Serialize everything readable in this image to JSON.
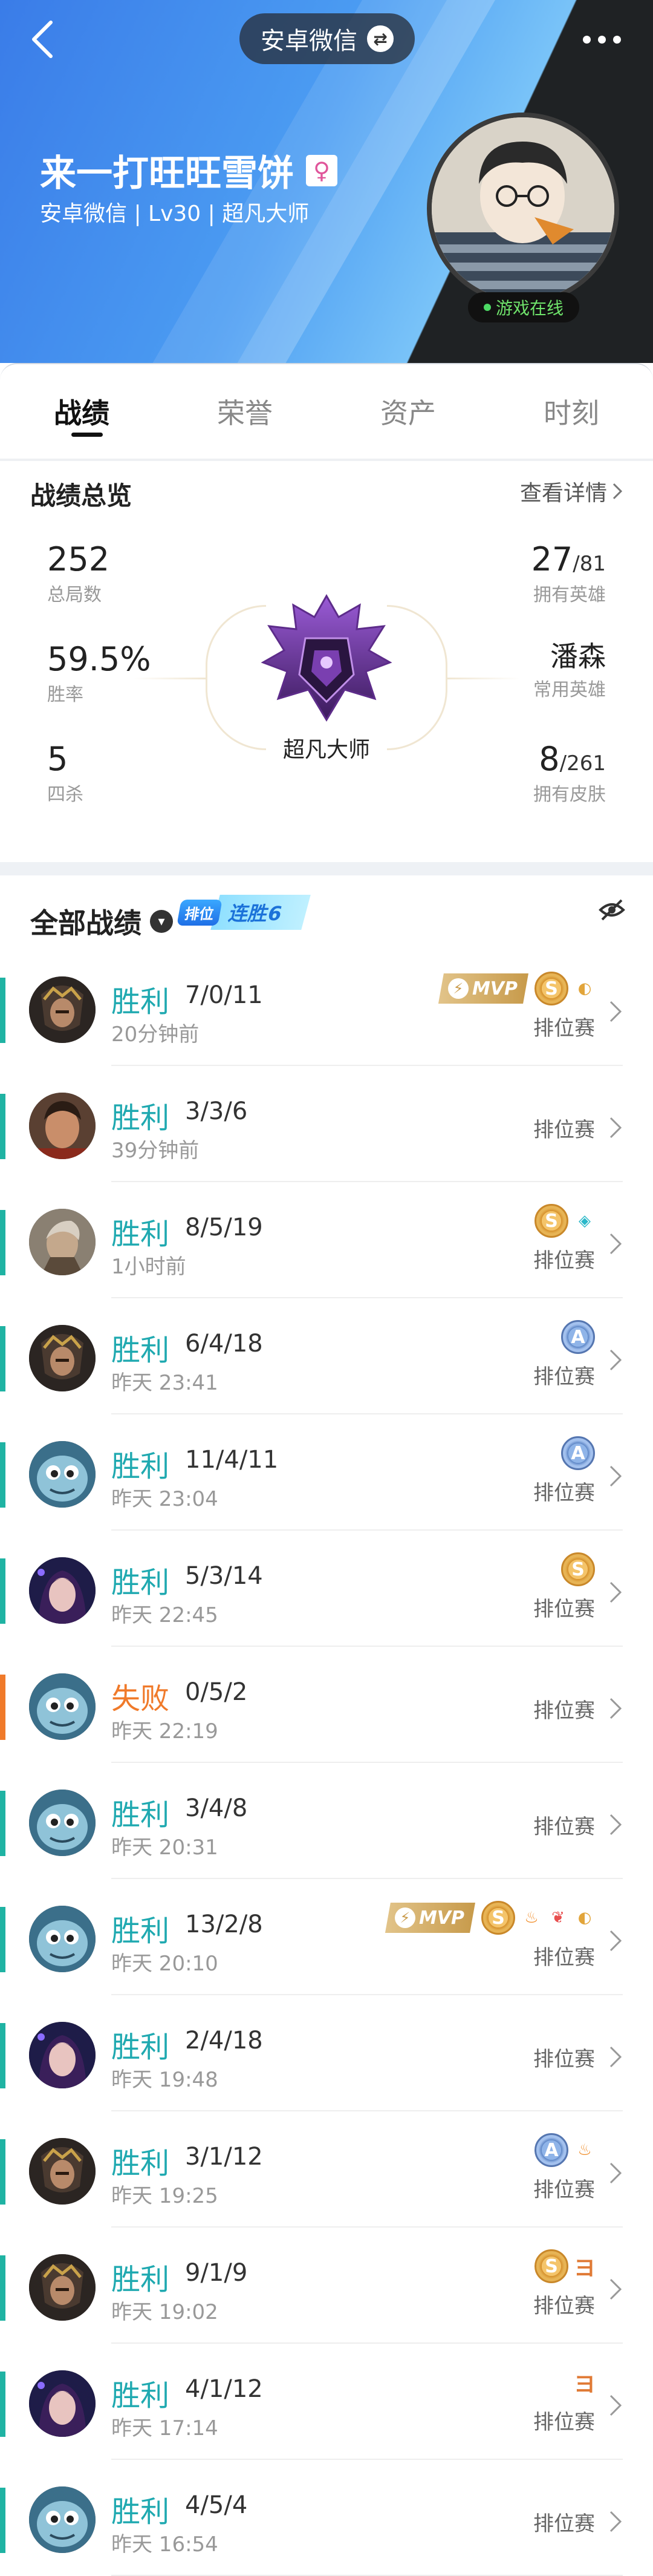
{
  "header": {
    "platform": "安卓微信",
    "player_name": "来一打旺旺雪饼",
    "player_sub": "安卓微信 | Lv30 | 超凡大师",
    "online_status": "游戏在线",
    "gender_icon": "female-icon"
  },
  "tabs": [
    {
      "label": "战绩",
      "active": true
    },
    {
      "label": "荣誉",
      "active": false
    },
    {
      "label": "资产",
      "active": false
    },
    {
      "label": "时刻",
      "active": false
    }
  ],
  "summary": {
    "title": "战绩总览",
    "detail_link": "查看详情",
    "total_games": {
      "value": "252",
      "label": "总局数"
    },
    "win_rate": {
      "value": "59.5%",
      "label": "胜率"
    },
    "penta": {
      "value": "5",
      "label": "四杀"
    },
    "heroes": {
      "value": "27",
      "total": "/81",
      "label": "拥有英雄"
    },
    "common_hero": {
      "value": "潘森",
      "label": "常用英雄"
    },
    "skins": {
      "value": "8",
      "total": "/261",
      "label": "拥有皮肤"
    },
    "rank_name": "超凡大师"
  },
  "records": {
    "title": "全部战绩",
    "streak_prefix": "排位",
    "streak_label": "连胜6"
  },
  "matches": [
    {
      "result": "胜利",
      "outcome": "win",
      "kda": "7/0/11",
      "time": "20分钟前",
      "mode": "排位赛",
      "hero": "dark-knight",
      "badges": [
        "mvp",
        "S",
        "coin"
      ]
    },
    {
      "result": "胜利",
      "outcome": "win",
      "kda": "3/3/6",
      "time": "39分钟前",
      "mode": "排位赛",
      "hero": "fighter",
      "badges": []
    },
    {
      "result": "胜利",
      "outcome": "win",
      "kda": "8/5/19",
      "time": "1小时前",
      "mode": "排位赛",
      "hero": "warrior",
      "badges": [
        "S",
        "shield"
      ]
    },
    {
      "result": "胜利",
      "outcome": "win",
      "kda": "6/4/18",
      "time": "昨天 23:41",
      "mode": "排位赛",
      "hero": "dark-knight",
      "badges": [
        "A"
      ]
    },
    {
      "result": "胜利",
      "outcome": "win",
      "kda": "11/4/11",
      "time": "昨天 23:04",
      "mode": "排位赛",
      "hero": "fish",
      "badges": [
        "A"
      ]
    },
    {
      "result": "胜利",
      "outcome": "win",
      "kda": "5/3/14",
      "time": "昨天 22:45",
      "mode": "排位赛",
      "hero": "sorceress",
      "badges": [
        "S"
      ]
    },
    {
      "result": "失败",
      "outcome": "loss",
      "kda": "0/5/2",
      "time": "昨天 22:19",
      "mode": "排位赛",
      "hero": "fish",
      "badges": []
    },
    {
      "result": "胜利",
      "outcome": "win",
      "kda": "3/4/8",
      "time": "昨天 20:31",
      "mode": "排位赛",
      "hero": "fish",
      "badges": []
    },
    {
      "result": "胜利",
      "outcome": "win",
      "kda": "13/2/8",
      "time": "昨天 20:10",
      "mode": "排位赛",
      "hero": "fish",
      "badges": [
        "mvp",
        "S",
        "fire",
        "wing",
        "coin"
      ]
    },
    {
      "result": "胜利",
      "outcome": "win",
      "kda": "2/4/18",
      "time": "昨天 19:48",
      "mode": "排位赛",
      "hero": "sorceress",
      "badges": []
    },
    {
      "result": "胜利",
      "outcome": "win",
      "kda": "3/1/12",
      "time": "昨天 19:25",
      "mode": "排位赛",
      "hero": "dark-knight",
      "badges": [
        "A",
        "fire"
      ]
    },
    {
      "result": "胜利",
      "outcome": "win",
      "kda": "9/1/9",
      "time": "昨天 19:02",
      "mode": "排位赛",
      "hero": "dark-knight",
      "badges": [
        "S",
        "three"
      ]
    },
    {
      "result": "胜利",
      "outcome": "win",
      "kda": "4/1/12",
      "time": "昨天 17:14",
      "mode": "排位赛",
      "hero": "sorceress",
      "badges": [
        "three"
      ]
    },
    {
      "result": "胜利",
      "outcome": "win",
      "kda": "4/5/4",
      "time": "昨天 16:54",
      "mode": "排位赛",
      "hero": "fish",
      "badges": []
    }
  ],
  "badge_texts": {
    "mvp": "MVP",
    "S": "S",
    "A": "A",
    "coin": "◐",
    "fire": "♨",
    "wing": "❦",
    "shield": "◈",
    "three": "ヨ"
  },
  "colors": {
    "win": "#1fb3a3",
    "loss": "#f07a2a",
    "accent_blue": "#3a7ce8"
  }
}
